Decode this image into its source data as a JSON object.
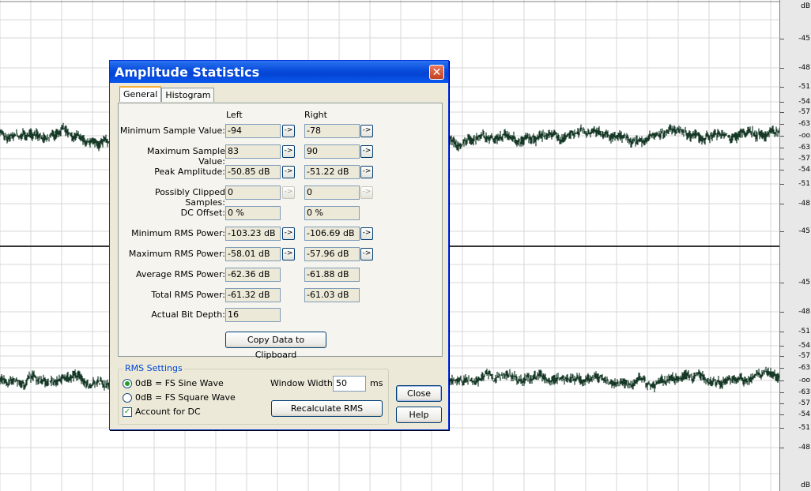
{
  "ruler": {
    "top_label": "dB",
    "bottom_label": "dB",
    "ticks_top": [
      "-45",
      "-48",
      "-51",
      "-54",
      "-57",
      "-63",
      "-oo",
      "-63",
      "-57",
      "-54",
      "-51",
      "-48",
      "-45"
    ],
    "ticks_bottom": [
      "-45",
      "-48",
      "-51",
      "-54",
      "-57",
      "-63",
      "-oo",
      "-63",
      "-57",
      "-54",
      "-51",
      "-48"
    ]
  },
  "wave": {
    "color": "#163826",
    "grid_color": "#d7d7d7"
  },
  "dialog": {
    "title": "Amplitude Statistics",
    "close_glyph": "✕",
    "tabs": [
      {
        "label": "General"
      },
      {
        "label": "Histogram"
      }
    ],
    "columns": {
      "left": "Left",
      "right": "Right"
    },
    "arrow_glyph": "->",
    "rows": [
      {
        "label": "Minimum Sample Value:",
        "left": "-94",
        "right": "-78"
      },
      {
        "label": "Maximum Sample Value:",
        "left": "83",
        "right": "90"
      },
      {
        "label": "Peak Amplitude:",
        "left": "-50.85 dB",
        "right": "-51.22 dB"
      },
      {
        "label": "Possibly Clipped Samples:",
        "left": "0",
        "right": "0"
      },
      {
        "label": "DC Offset:",
        "left": "0 %",
        "right": "0 %"
      },
      {
        "label": "Minimum RMS Power:",
        "left": "-103.23 dB",
        "right": "-106.69 dB"
      },
      {
        "label": "Maximum RMS Power:",
        "left": "-58.01 dB",
        "right": "-57.96 dB"
      },
      {
        "label": "Average RMS Power:",
        "left": "-62.36 dB",
        "right": "-61.88 dB"
      },
      {
        "label": "Total RMS Power:",
        "left": "-61.32 dB",
        "right": "-61.03 dB"
      },
      {
        "label": "Actual Bit Depth:",
        "left": "16"
      }
    ],
    "copy_button": "Copy Data to Clipboard",
    "rms": {
      "title": "RMS Settings",
      "sine": "0dB = FS Sine Wave",
      "square": "0dB = FS Square Wave",
      "account_dc": "Account for DC",
      "window_label": "Window Width:",
      "window_value": "50",
      "window_unit": "ms",
      "recalc": "Recalculate RMS",
      "check_glyph": "✓"
    },
    "close_button": "Close",
    "help_button": "Help"
  }
}
